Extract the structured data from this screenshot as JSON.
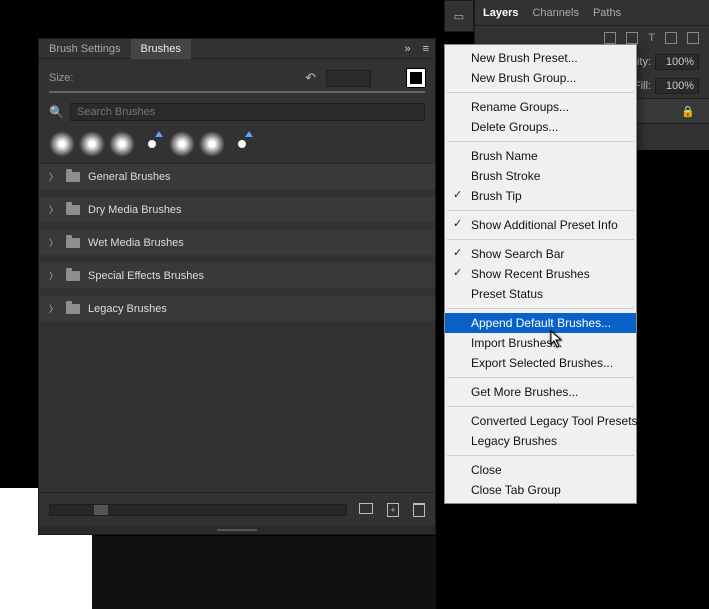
{
  "brush_panel": {
    "tabs": {
      "settings": "Brush Settings",
      "brushes": "Brushes"
    },
    "size_label": "Size:",
    "size_value": "",
    "search_placeholder": "Search Brushes",
    "folders": [
      "General Brushes",
      "Dry Media Brushes",
      "Wet Media Brushes",
      "Special Effects Brushes",
      "Legacy Brushes"
    ]
  },
  "layers_panel": {
    "tabs": {
      "layers": "Layers",
      "channels": "Channels",
      "paths": "Paths"
    },
    "opacity_label": "city:",
    "opacity_value": "100%",
    "fill_label": "Fill:",
    "fill_value": "100%"
  },
  "flyout": {
    "items": [
      {
        "label": "New Brush Preset...",
        "check": false
      },
      {
        "label": "New Brush Group...",
        "check": false
      },
      {
        "sep": true
      },
      {
        "label": "Rename Groups...",
        "check": false
      },
      {
        "label": "Delete Groups...",
        "check": false
      },
      {
        "sep": true
      },
      {
        "label": "Brush Name",
        "check": false
      },
      {
        "label": "Brush Stroke",
        "check": false
      },
      {
        "label": "Brush Tip",
        "check": true
      },
      {
        "sep": true
      },
      {
        "label": "Show Additional Preset Info",
        "check": true
      },
      {
        "sep": true
      },
      {
        "label": "Show Search Bar",
        "check": true
      },
      {
        "label": "Show Recent Brushes",
        "check": true
      },
      {
        "label": "Preset Status",
        "check": false
      },
      {
        "sep": true
      },
      {
        "label": "Append Default Brushes...",
        "check": false,
        "highlight": true
      },
      {
        "label": "Import Brushes...",
        "check": false
      },
      {
        "label": "Export Selected Brushes...",
        "check": false
      },
      {
        "sep": true
      },
      {
        "label": "Get More Brushes...",
        "check": false
      },
      {
        "sep": true
      },
      {
        "label": "Converted Legacy Tool Presets",
        "check": false
      },
      {
        "label": "Legacy Brushes",
        "check": false
      },
      {
        "sep": true
      },
      {
        "label": "Close",
        "check": false
      },
      {
        "label": "Close Tab Group",
        "check": false
      }
    ]
  }
}
